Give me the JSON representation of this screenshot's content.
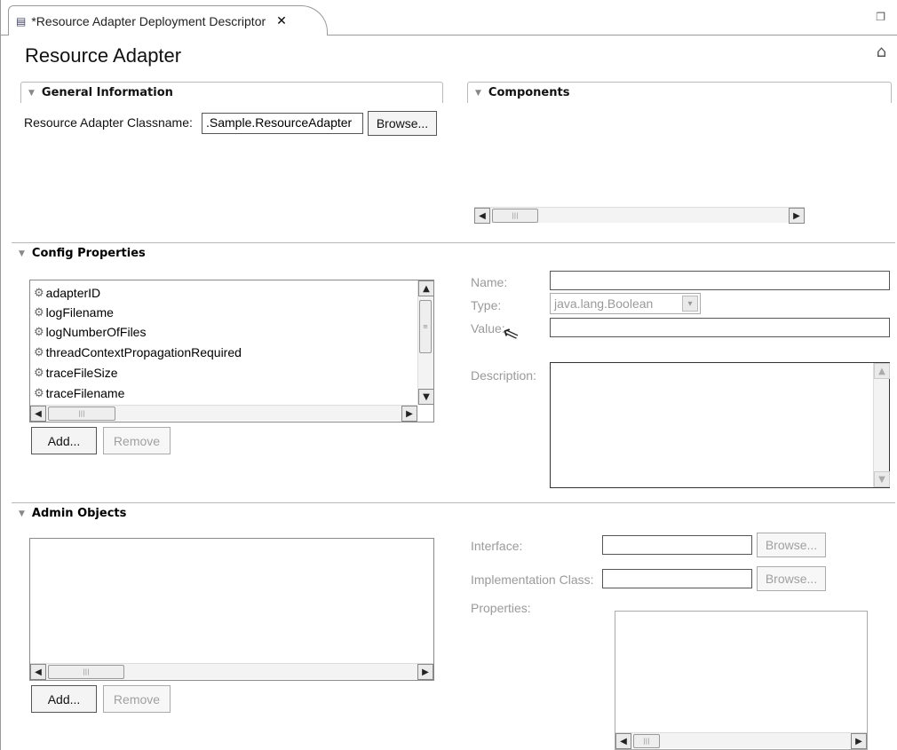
{
  "tab": {
    "title": "*Resource Adapter Deployment Descriptor",
    "close_icon": "close-icon",
    "restore_icon": "restore-icon"
  },
  "page": {
    "title": "Resource Adapter",
    "home_icon": "home-icon"
  },
  "general": {
    "title": "General Information",
    "classname_label": "Resource Adapter Classname:",
    "classname_value": ".Sample.ResourceAdapter",
    "browse": "Browse..."
  },
  "components": {
    "title": "Components"
  },
  "config": {
    "title": "Config Properties",
    "items": [
      "adapterID",
      "logFilename",
      "logNumberOfFiles",
      "threadContextPropagationRequired",
      "traceFileSize",
      "traceFilename"
    ],
    "add": "Add...",
    "remove": "Remove",
    "name_label": "Name:",
    "type_label": "Type:",
    "type_value": "java.lang.Boolean",
    "value_label": "Value:",
    "description_label": "Description:"
  },
  "admin": {
    "title": "Admin Objects",
    "add": "Add...",
    "remove": "Remove",
    "interface_label": "Interface:",
    "impl_label": "Implementation Class:",
    "properties_label": "Properties:",
    "browse": "Browse..."
  }
}
